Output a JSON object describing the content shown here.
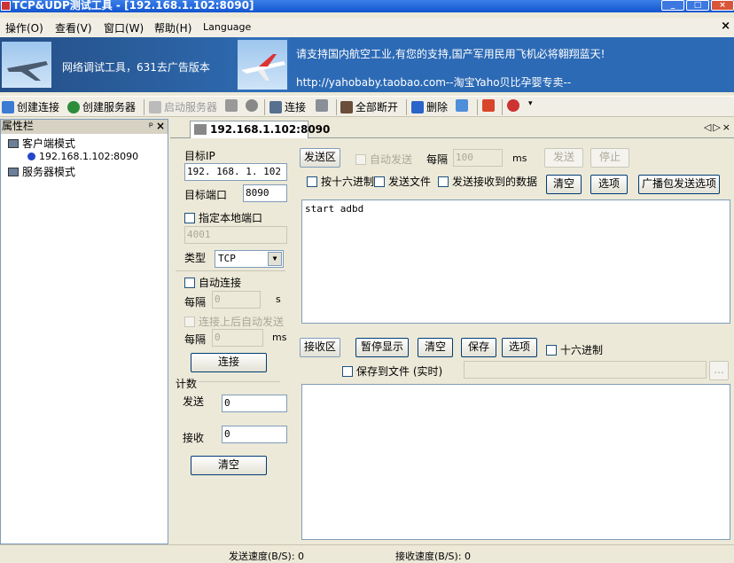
{
  "window": {
    "title": "TCP&UDP测试工具 - [192.168.1.102:8090]"
  },
  "menu": {
    "items": [
      "操作(O)",
      "查看(V)",
      "窗口(W)",
      "帮助(H)",
      "Language"
    ],
    "close": "×"
  },
  "banner": {
    "left_text": "网络调试工具，631去广告版本",
    "right_text1": "请支持国内航空工业,有您的支持,国产军用民用飞机必将翱翔蓝天!",
    "right_text2": "http://yahobaby.taobao.com--淘宝Yaho贝比孕婴专卖--"
  },
  "toolbar": {
    "create_connection": "创建连接",
    "create_server": "创建服务器",
    "start_server": "启动服务器",
    "connect": "连接",
    "disconnect_all": "全部断开",
    "delete": "删除"
  },
  "sidebar": {
    "title": "属性栏",
    "pin": "ᵖ",
    "close": "×",
    "client_mode": "客户端模式",
    "client_item": "192.168.1.102:8090",
    "server_mode": "服务器模式"
  },
  "tab": {
    "label": "192.168.1.102:8090",
    "controls": "◁▷×"
  },
  "conn": {
    "target_ip_label": "目标IP",
    "target_ip": "192. 168. 1. 102",
    "target_port_label": "目标端口",
    "target_port": "8090",
    "local_port_label": "指定本地端口",
    "local_port": "4001",
    "type_label": "类型",
    "type_value": "TCP",
    "auto_connect_label": "自动连接",
    "interval_label": "每隔",
    "interval_value": "0",
    "interval_unit": "s",
    "auto_send_after_label": "连接上后自动发送",
    "interval2_label": "每隔",
    "interval2_value": "0",
    "interval2_unit": "ms",
    "connect_button": "连接"
  },
  "count": {
    "title": "计数",
    "send_label": "发送",
    "send_value": "0",
    "recv_label": "接收",
    "recv_value": "0",
    "clear_button": "清空"
  },
  "send": {
    "area_label": "发送区",
    "auto_send": "自动发送",
    "interval_label": "每隔",
    "interval_value": "100",
    "interval_unit": "ms",
    "send_button": "发送",
    "stop_button": "停止",
    "hex_label": "按十六进制",
    "send_file_label": "发送文件",
    "send_received_label": "发送接收到的数据",
    "clear_button": "清空",
    "options_button": "选项",
    "broadcast_button": "广播包发送选项",
    "content": "start  adbd"
  },
  "recv": {
    "area_label": "接收区",
    "pause_button": "暂停显示",
    "clear_button": "清空",
    "save_button": "保存",
    "options_button": "选项",
    "hex_label": "十六进制",
    "save_file_label": "保存到文件 (实时)",
    "browse_button": "..."
  },
  "status": {
    "send_speed": "发送速度(B/S): 0",
    "recv_speed": "接收速度(B/S): 0"
  }
}
